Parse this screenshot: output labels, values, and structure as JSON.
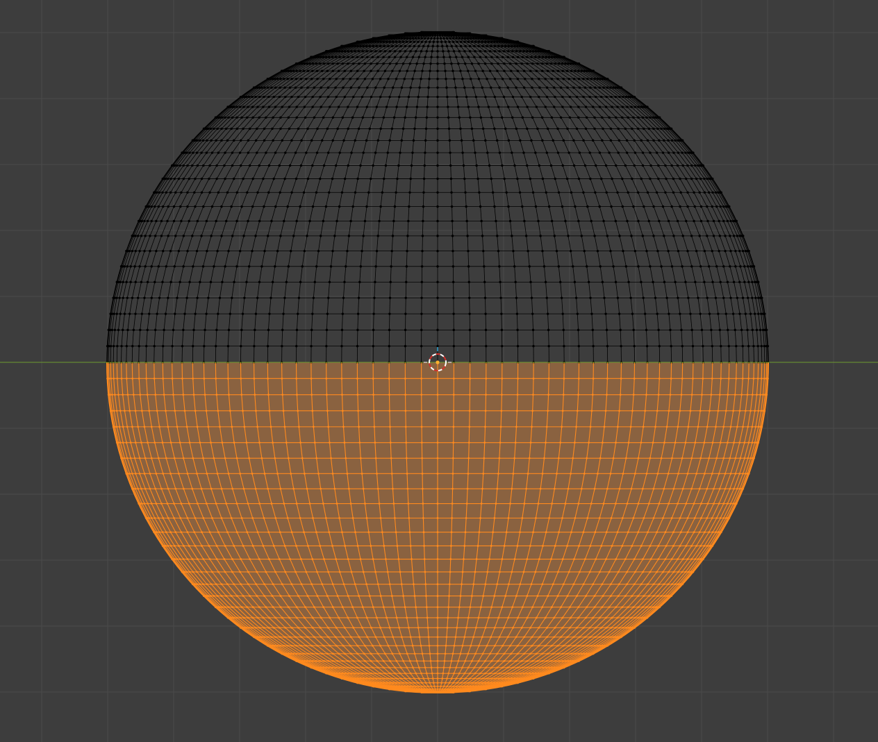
{
  "viewport": {
    "mode": "edit-mode",
    "projection": "front-orthographic",
    "background_color": "#3d3d3d",
    "grid_line_color": "#4a4a4a",
    "x_axis_color": "#6e9a2f"
  },
  "mesh": {
    "type": "uv-sphere",
    "segments": 128,
    "rings": 64,
    "selection": "lower-hemisphere",
    "unselected_wire_color": "#000000",
    "unselected_vertex_color": "#000000",
    "selected_wire_color": "#ff8a1e",
    "selected_face_color": "#8a6240"
  },
  "origin": {
    "icon": "3d-cursor-icon",
    "ring_colors": [
      "#ffffff",
      "#d0302a"
    ],
    "dot_color": "#ffb030"
  }
}
